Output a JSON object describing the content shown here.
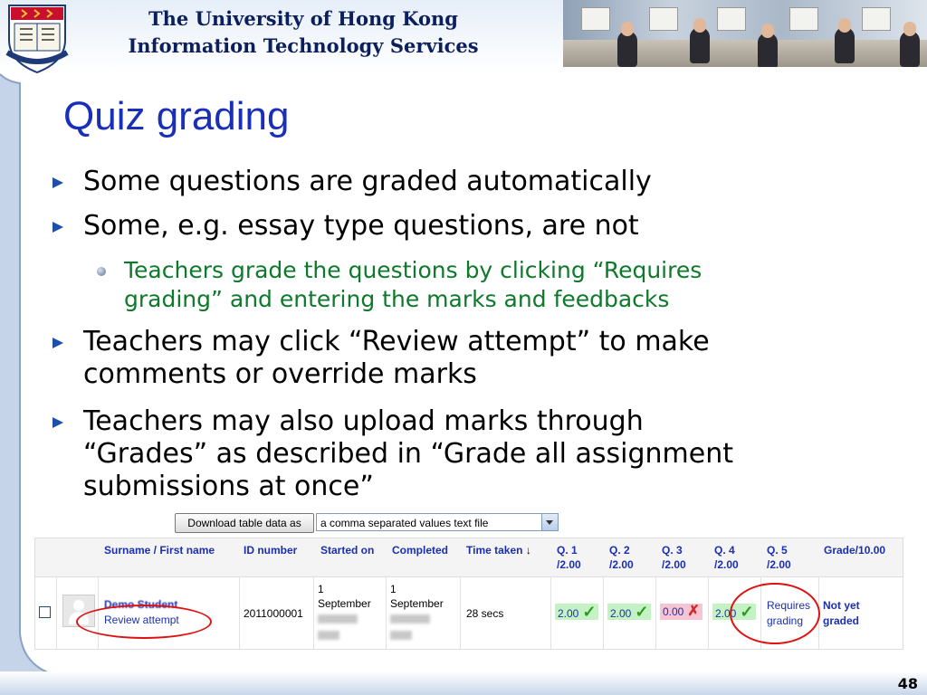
{
  "header": {
    "line1": "The University of Hong Kong",
    "line2": "Information Technology Services",
    "crest_motto": "SAPIENTIA ET VIRTUS",
    "crest_chars": "明德格物"
  },
  "slide": {
    "title": "Quiz grading",
    "bullets": [
      {
        "text": "Some questions are graded automatically"
      },
      {
        "text": "Some, e.g. essay type questions, are not"
      },
      {
        "text": "Teachers grade the questions by clicking “Requires grading” and entering the marks and feedbacks"
      },
      {
        "text": "Teachers may click “Review attempt” to make comments or override marks"
      },
      {
        "text": "Teachers may also upload marks through “Grades” as described in “Grade all assignment submissions at once”"
      }
    ],
    "sub_lines": [
      "Teachers grade the questions by clicking “Requires",
      "grading” and entering the marks and feedbacks"
    ],
    "b3_lines": [
      "Teachers may click “Review attempt” to make",
      "comments or override marks"
    ],
    "b4_lines": [
      "Teachers may also upload marks through",
      "“Grades” as described in “Grade all assignment",
      "submissions at once”"
    ],
    "page_number": "48"
  },
  "download": {
    "button_label": "Download table data as",
    "format_selected": "a comma separated values text file"
  },
  "table": {
    "headers": {
      "name": "Surname / First name",
      "id": "ID number",
      "started": "Started on",
      "completed": "Completed",
      "time": "Time taken",
      "time_sort": "↓",
      "q1a": "Q. 1",
      "q1b": "/2.00",
      "q2a": "Q. 2",
      "q2b": "/2.00",
      "q3a": "Q. 3",
      "q3b": "/2.00",
      "q4a": "Q. 4",
      "q4b": "/2.00",
      "q5a": "Q. 5",
      "q5b": "/2.00",
      "grade": "Grade/10.00"
    },
    "row": {
      "name": "Demo Student",
      "review": "Review attempt",
      "id": "2011000001",
      "started_day": "1",
      "started_month": "September",
      "completed_day": "1",
      "completed_month": "September",
      "time_taken": "28 secs",
      "q1": "2.00",
      "q2": "2.00",
      "q3": "0.00",
      "q4": "2.00",
      "q5_line1": "Requires",
      "q5_line2": "grading",
      "grade_line1": "Not yet",
      "grade_line2": "graded"
    }
  },
  "colors": {
    "title": "#1a2fb8",
    "sub_bullet": "#0c7a2a",
    "table_header": "#1b2fb0",
    "correct_bg": "#c4f2c4",
    "wrong_bg": "#f7c4d4",
    "highlight_oval": "#e01010"
  }
}
